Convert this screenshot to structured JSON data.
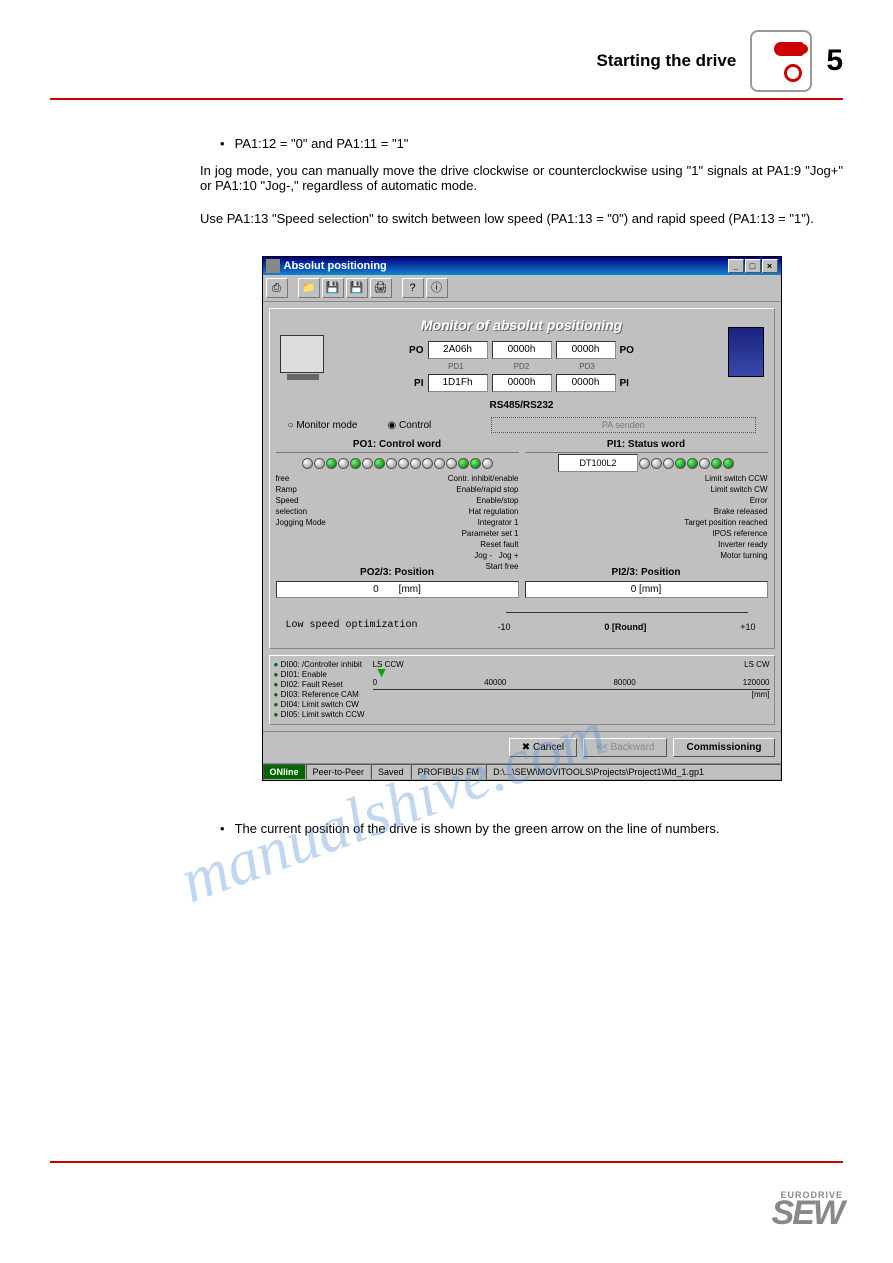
{
  "header": {
    "title": "Starting the drive",
    "page_number": "5"
  },
  "body": {
    "bullet1": "PA1:12 = \"0\" and PA1:11 = \"1\"",
    "para1": "In jog mode, you can manually move the drive clockwise or counterclockwise using \"1\" signals at PA1:9 \"Jog+\" or PA1:10 \"Jog-,\" regardless of automatic mode.",
    "para2": "Use PA1:13 \"Speed selection\" to switch between low speed (PA1:13 = \"0\") and rapid speed (PA1:13 = \"1\").",
    "bullet2": "The current position of the drive is shown by the green arrow on the line of numbers."
  },
  "window": {
    "title": "Absolut positioning",
    "monitor_title": "Monitor of absolut positioning",
    "po_label": "PO",
    "pi_label": "PI",
    "po_values": [
      "2A06h",
      "0000h",
      "0000h"
    ],
    "pi_values": [
      "1D1Fh",
      "0000h",
      "0000h"
    ],
    "pd_labels": [
      "PD1",
      "PD2",
      "PD3"
    ],
    "bus_label": "RS485/RS232",
    "radio_monitor": "Monitor mode",
    "radio_control": "Control",
    "pa_button": "PA senden",
    "po1_title": "PO1: Control word",
    "pi1_title": "PI1: Status word",
    "device_name": "DT100L2",
    "po2_title": "PO2/3: Position",
    "pi2_title": "PI2/3: Position",
    "po_bits_left": [
      "free",
      "Ramp",
      "Speed",
      "selection",
      "Jogging Mode"
    ],
    "po_bits_right": [
      "Contr. inhibit/enable",
      "Enable/rapid stop",
      "Enable/stop",
      "Hat regulation",
      "Integrator 1",
      "Parameter set 1",
      "Reset fault",
      "Jog -",
      "Jog +",
      "Start  free"
    ],
    "pi_bits_right": [
      "Limit switch CCW",
      "Limit switch CW",
      "Error",
      "Brake released",
      "Target position reached",
      "IPOS reference",
      "Inverter ready",
      "Motor turning"
    ],
    "po_pos_val": "0",
    "po_pos_unit": "[mm]",
    "pi_pos_val": "0 [mm]",
    "opt_text": "Low speed optimization",
    "slider": {
      "min": "-10",
      "mid": "0 [Round]",
      "max": "+10"
    },
    "dio": [
      "DI00: /Controller inhibit",
      "DI01: Enable",
      "DI02: Fault Reset",
      "DI03: Reference CAM",
      "DI04: Limit switch CW",
      "DI05: Limit switch CCW"
    ],
    "axis_ticks": [
      "0",
      "40000",
      "80000",
      "120000"
    ],
    "axis_unit": "[mm]",
    "ls_ccw": "LS CCW",
    "ls_cw": "LS CW",
    "buttons": {
      "cancel": "Cancel",
      "back": "<< Backward",
      "commission": "Commissioning"
    },
    "status": {
      "online": "ONline",
      "peer": "Peer-to-Peer",
      "saved": "Saved",
      "profibus": "PROFIBUS FM",
      "path": "D:\\...\\SEW\\MOVITOOLS\\Projects\\Project1\\Md_1.gp1"
    }
  },
  "watermark": "manualshive.com",
  "footer": {
    "brand": "SEW",
    "sub": "EURODRIVE"
  }
}
